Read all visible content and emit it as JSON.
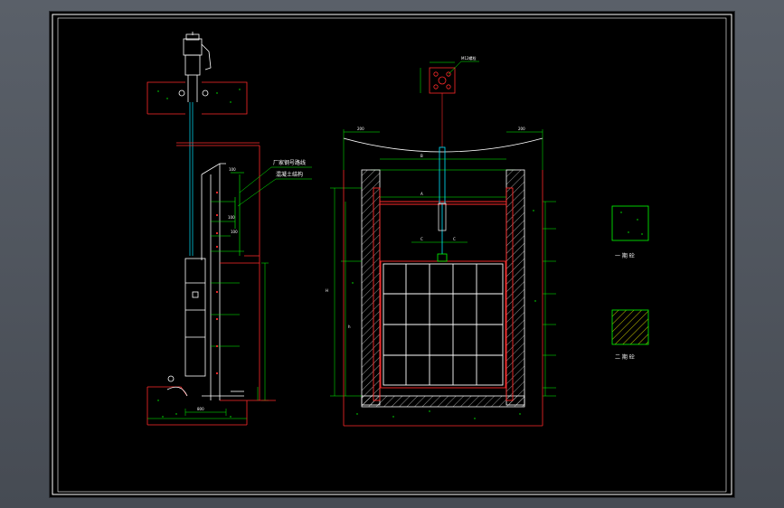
{
  "colors": {
    "background": "#000000",
    "border": "#ffffff",
    "structure": "#ffffff",
    "concrete": "#ff2a2a",
    "dimension": "#00ff00",
    "gate": "#ffffff",
    "stem": "#00e5ff",
    "annotation": "#ffff00"
  },
  "drawing": {
    "side_view": {
      "callouts": [
        "厂家钢号路线",
        "混凝土结构"
      ],
      "dims": {
        "slot_width": "100",
        "upper": "100",
        "lower": "100",
        "base": "800"
      }
    },
    "front_view": {
      "top_callout": "M12螺栓",
      "dims": {
        "left_wall": "200",
        "right_wall": "200",
        "clear_span": "B",
        "frame_width": "A",
        "stem_center_left": "C",
        "stem_center_right": "C",
        "height_total": "H",
        "height_gate": "h"
      }
    },
    "legend": [
      {
        "label": "一 期 砼"
      },
      {
        "label": "二 期 砼"
      }
    ]
  }
}
